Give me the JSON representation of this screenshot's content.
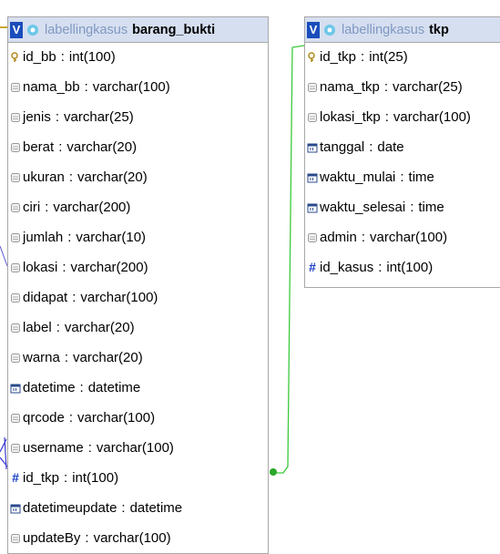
{
  "tables": {
    "barang_bukti": {
      "badge": "V",
      "db": "labellingkasus",
      "name": "barang_bukti",
      "columns": [
        {
          "name": "id_bb",
          "type": "int(100)",
          "icon": "key-icon"
        },
        {
          "name": "nama_bb",
          "type": "varchar(100)",
          "icon": "column-icon"
        },
        {
          "name": "jenis",
          "type": "varchar(25)",
          "icon": "column-icon"
        },
        {
          "name": "berat",
          "type": "varchar(20)",
          "icon": "column-icon"
        },
        {
          "name": "ukuran",
          "type": "varchar(20)",
          "icon": "column-icon"
        },
        {
          "name": "ciri",
          "type": "varchar(200)",
          "icon": "column-icon"
        },
        {
          "name": "jumlah",
          "type": "varchar(10)",
          "icon": "column-icon"
        },
        {
          "name": "lokasi",
          "type": "varchar(200)",
          "icon": "column-icon"
        },
        {
          "name": "didapat",
          "type": "varchar(100)",
          "icon": "column-icon"
        },
        {
          "name": "label",
          "type": "varchar(20)",
          "icon": "column-icon"
        },
        {
          "name": "warna",
          "type": "varchar(20)",
          "icon": "column-icon"
        },
        {
          "name": "datetime",
          "type": "datetime",
          "icon": "date-icon"
        },
        {
          "name": "qrcode",
          "type": "varchar(100)",
          "icon": "column-icon"
        },
        {
          "name": "username",
          "type": "varchar(100)",
          "icon": "column-icon"
        },
        {
          "name": "id_tkp",
          "type": "int(100)",
          "icon": "hash-icon"
        },
        {
          "name": "datetimeupdate",
          "type": "datetime",
          "icon": "date-icon"
        },
        {
          "name": "updateBy",
          "type": "varchar(100)",
          "icon": "column-icon"
        }
      ]
    },
    "tkp": {
      "badge": "V",
      "db": "labellingkasus",
      "name": "tkp",
      "columns": [
        {
          "name": "id_tkp",
          "type": "int(25)",
          "icon": "key-icon"
        },
        {
          "name": "nama_tkp",
          "type": "varchar(25)",
          "icon": "column-icon"
        },
        {
          "name": "lokasi_tkp",
          "type": "varchar(100)",
          "icon": "column-icon"
        },
        {
          "name": "tanggal",
          "type": "date",
          "icon": "date-icon"
        },
        {
          "name": "waktu_mulai",
          "type": "time",
          "icon": "date-icon"
        },
        {
          "name": "waktu_selesai",
          "type": "time",
          "icon": "date-icon"
        },
        {
          "name": "admin",
          "type": "varchar(100)",
          "icon": "column-icon"
        },
        {
          "name": "id_kasus",
          "type": "int(100)",
          "icon": "hash-icon"
        }
      ]
    }
  },
  "colors": {
    "relation_line": "#3cc93c",
    "header_bg": "#d6dff0",
    "badge_bg": "#1a4dbb",
    "db_name": "#7f98c2"
  },
  "separator": ":"
}
